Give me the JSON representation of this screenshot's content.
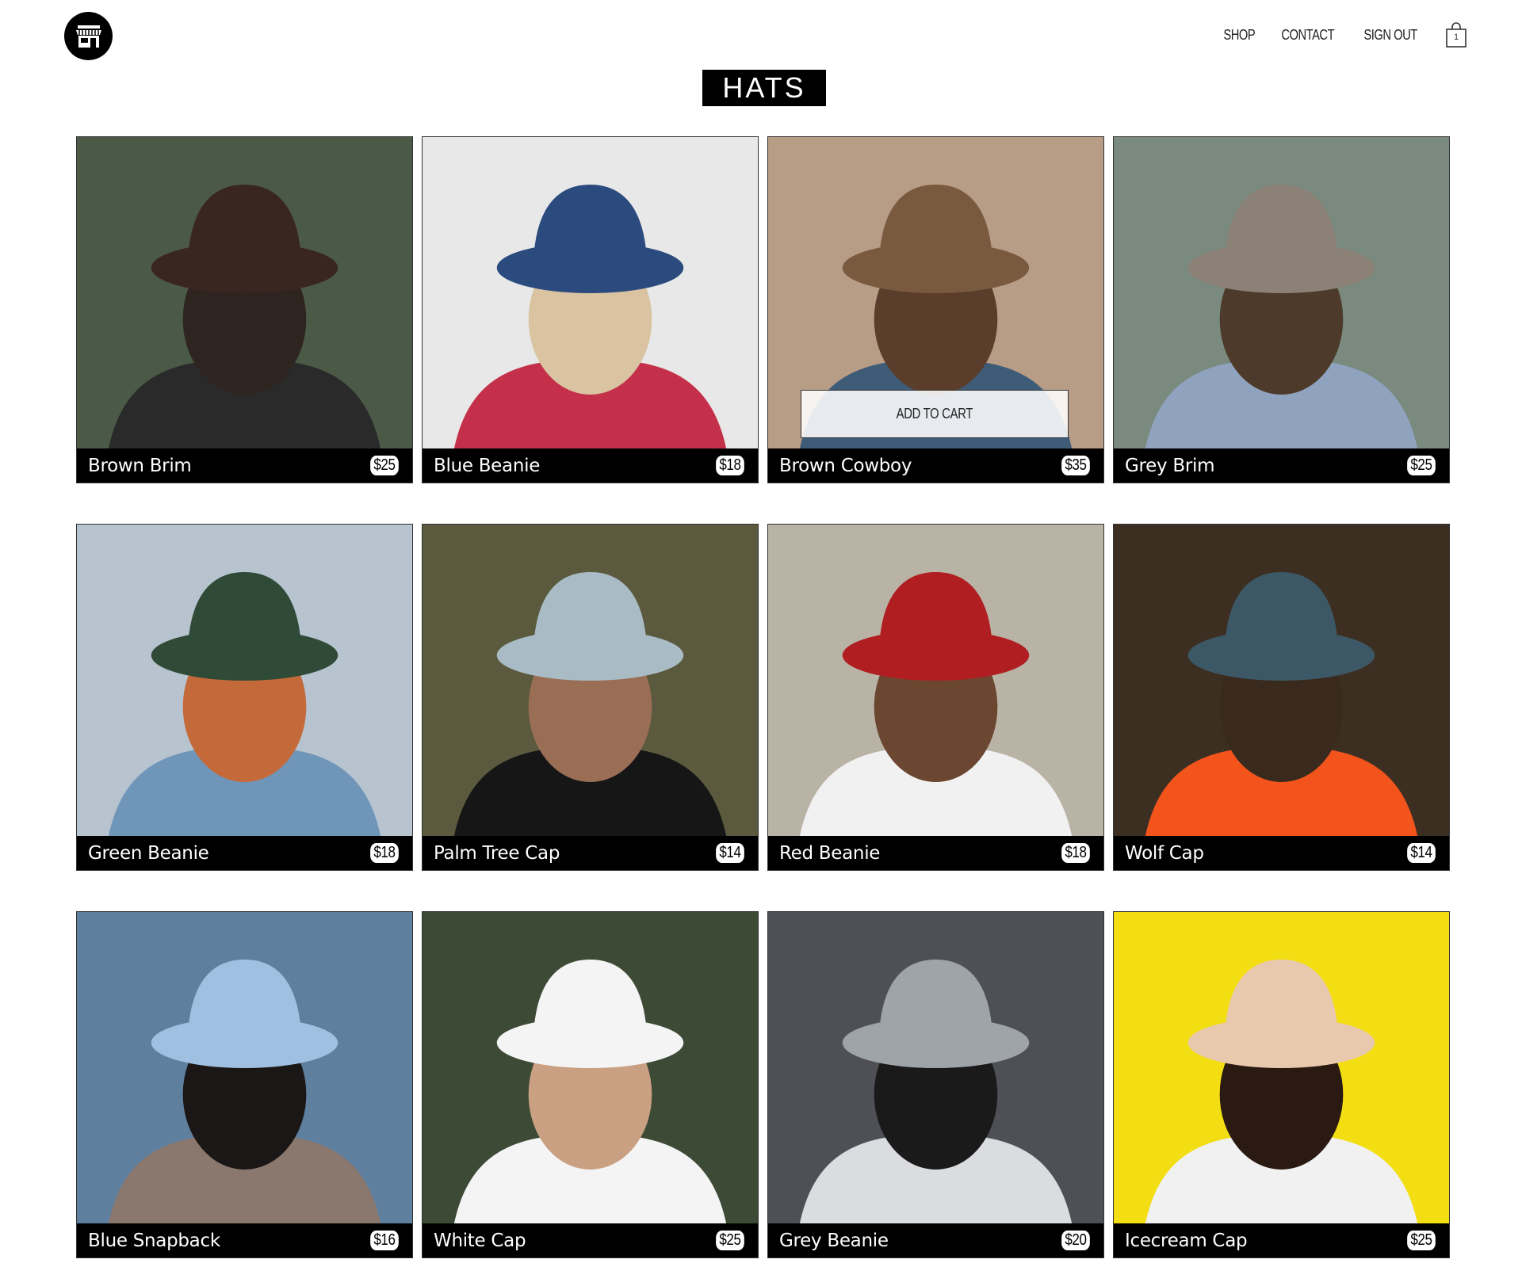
{
  "header": {
    "logo_icon": "store-icon",
    "nav": [
      {
        "label": "SHOP"
      },
      {
        "label": "CONTACT"
      },
      {
        "label": "SIGN OUT"
      }
    ],
    "cart": {
      "icon": "shopping-bag-icon",
      "count": "1"
    }
  },
  "page_title": "HATS",
  "add_to_cart_label": "ADD TO CART",
  "products": [
    {
      "name": "Brown Brim",
      "price": "$25",
      "bg": "#4b5a46",
      "subject": "#2e2420",
      "hat": "#3a2620",
      "clothes": "#2a2a2a"
    },
    {
      "name": "Blue Beanie",
      "price": "$18",
      "bg": "#e8e8e8",
      "subject": "#d9c3a0",
      "hat": "#2b4a7e",
      "clothes": "#c4304a"
    },
    {
      "name": "Brown Cowboy",
      "price": "$35",
      "bg": "#b79c86",
      "subject": "#5a3d2a",
      "hat": "#7a5a3e",
      "clothes": "#3e5b78"
    },
    {
      "name": "Grey Brim",
      "price": "$25",
      "bg": "#7a8a7e",
      "subject": "#4d3a2a",
      "hat": "#8b8176",
      "clothes": "#8fa3bf"
    },
    {
      "name": "Green Beanie",
      "price": "$18",
      "bg": "#b7c3ce",
      "subject": "#c46a3a",
      "hat": "#2f4a36",
      "clothes": "#6f95b9"
    },
    {
      "name": "Palm Tree Cap",
      "price": "$14",
      "bg": "#5b5a3e",
      "subject": "#9a6e55",
      "hat": "#a9bcc6",
      "clothes": "#161616"
    },
    {
      "name": "Red Beanie",
      "price": "$18",
      "bg": "#b9b3a6",
      "subject": "#6b4630",
      "hat": "#b01e22",
      "clothes": "#f1f1f1"
    },
    {
      "name": "Wolf Cap",
      "price": "$14",
      "bg": "#3c2f22",
      "subject": "#3a2a1e",
      "hat": "#3c5866",
      "clothes": "#f2541c"
    },
    {
      "name": "Blue Snapback",
      "price": "$16",
      "bg": "#5f7f9f",
      "subject": "#1a1716",
      "hat": "#9fc0e0",
      "clothes": "#8a786e"
    },
    {
      "name": "White Cap",
      "price": "$25",
      "bg": "#3d4a36",
      "subject": "#caa082",
      "hat": "#f4f4f4",
      "clothes": "#f4f4f4"
    },
    {
      "name": "Grey Beanie",
      "price": "$20",
      "bg": "#4e5056",
      "subject": "#1b1a1a",
      "hat": "#9fa4aa",
      "clothes": "#dadce0"
    },
    {
      "name": "Icecream Cap",
      "price": "$25",
      "bg": "#f3dd13",
      "subject": "#2a1a12",
      "hat": "#e9c9ad",
      "clothes": "#f1f1f1"
    }
  ]
}
